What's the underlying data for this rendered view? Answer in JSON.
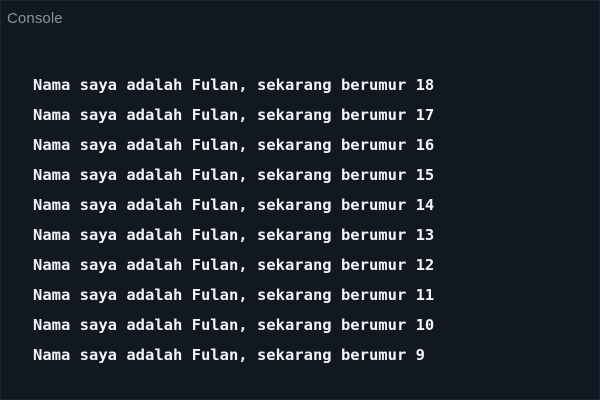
{
  "console": {
    "title": "Console",
    "lines": [
      "Nama saya adalah Fulan, sekarang berumur 18",
      "Nama saya adalah Fulan, sekarang berumur 17",
      "Nama saya adalah Fulan, sekarang berumur 16",
      "Nama saya adalah Fulan, sekarang berumur 15",
      "Nama saya adalah Fulan, sekarang berumur 14",
      "Nama saya adalah Fulan, sekarang berumur 13",
      "Nama saya adalah Fulan, sekarang berumur 12",
      "Nama saya adalah Fulan, sekarang berumur 11",
      "Nama saya adalah Fulan, sekarang berumur 10",
      "Nama saya adalah Fulan, sekarang berumur 9"
    ]
  },
  "colors": {
    "background": "#121821",
    "header_text": "#8b929b",
    "output_text": "#f2f4f7"
  }
}
